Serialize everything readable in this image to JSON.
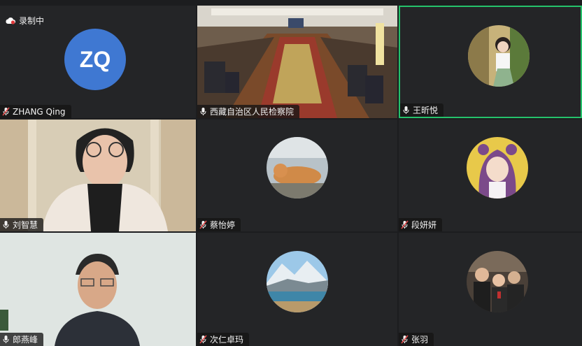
{
  "recording": {
    "label": "录制中",
    "icon": "cloud-record-icon"
  },
  "participants": [
    {
      "name": "ZHANG Qing",
      "initials": "ZQ",
      "mic": "mic-muted"
    },
    {
      "name": "西藏自治区人民检察院",
      "mic": "mic-on"
    },
    {
      "name": "王昕悦",
      "mic": "mic-on",
      "active": true
    },
    {
      "name": "刘智慧",
      "mic": "mic-on"
    },
    {
      "name": "蔡怡婷",
      "mic": "mic-muted"
    },
    {
      "name": "段妍妍",
      "mic": "mic-muted"
    },
    {
      "name": "郎燕峰",
      "mic": "mic-on"
    },
    {
      "name": "次仁卓玛",
      "mic": "mic-muted"
    },
    {
      "name": "张羽",
      "mic": "mic-muted"
    }
  ],
  "colors": {
    "active_border": "#25c26b",
    "initials_bg": "#3f78d2",
    "muted_mic": "#e04a4a"
  }
}
